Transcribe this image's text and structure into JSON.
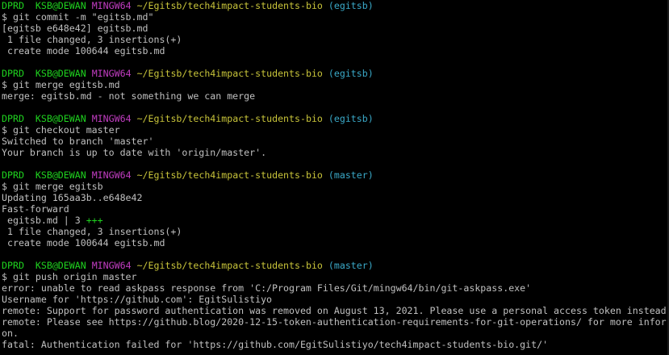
{
  "prompt": {
    "user": "DPRD",
    "host": "KSB@DEWAN",
    "shell": "MINGW64",
    "path": "~/Egitsb/tech4impact-students-bio"
  },
  "blocks": [
    {
      "branch": "(egitsb)",
      "command": "$ git commit -m \"egitsb.md\"",
      "output": [
        "[egitsb e648e42] egitsb.md",
        " 1 file changed, 3 insertions(+)",
        " create mode 100644 egitsb.md"
      ]
    },
    {
      "branch": "(egitsb)",
      "command": "$ git merge egitsb.md",
      "output": [
        "merge: egitsb.md - not something we can merge"
      ]
    },
    {
      "branch": "(egitsb)",
      "command": "$ git checkout master",
      "output": [
        "Switched to branch 'master'",
        "Your branch is up to date with 'origin/master'."
      ]
    },
    {
      "branch": "(master)",
      "command": "$ git merge egitsb",
      "output": [
        "Updating 165aa3b..e648e42",
        "Fast-forward"
      ],
      "stat_line": {
        "file": " egitsb.md | 3 ",
        "plus": "+++"
      },
      "output_after": [
        " 1 file changed, 3 insertions(+)",
        " create mode 100644 egitsb.md"
      ]
    },
    {
      "branch": "(master)",
      "command": "$ git push origin master",
      "output": [
        "error: unable to read askpass response from 'C:/Program Files/Git/mingw64/bin/git-askpass.exe'",
        "Username for 'https://github.com': EgitSulistiyo",
        "remote: Support for password authentication was removed on August 13, 2021. Please use a personal access token instead",
        "remote: Please see https://github.blog/2020-12-15-token-authentication-requirements-for-git-operations/ for more infor",
        "on.",
        "fatal: Authentication failed for 'https://github.com/EgitSulistiyo/tech4impact-students-bio.git/'"
      ]
    }
  ],
  "colors": {
    "background": "#000000",
    "text": "#c0c0c0",
    "user_host": "#1fd41f",
    "shell": "#c23dc2",
    "path": "#c8c43a",
    "branch": "#3aa9c8"
  }
}
